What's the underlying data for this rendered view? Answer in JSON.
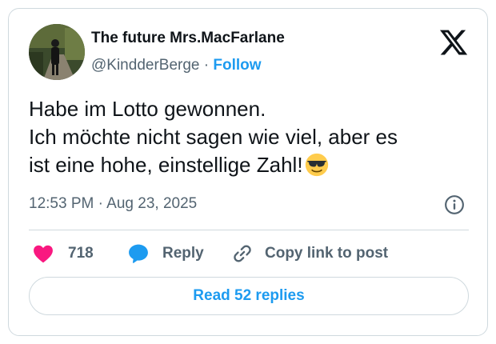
{
  "author": {
    "display_name": "The future Mrs.MacFarlane",
    "handle": "@KindderBerge",
    "separator": "·",
    "follow_label": "Follow"
  },
  "tweet": {
    "lines": [
      "Habe im Lotto gewonnen.",
      "Ich möchte nicht sagen wie viel, aber es",
      "ist eine hohe, einstellige Zahl!"
    ],
    "emoji": "smiling-face-with-sunglasses",
    "timestamp": "12:53 PM · Aug 23, 2025"
  },
  "actions": {
    "like_count": "718",
    "reply_label": "Reply",
    "copy_link_label": "Copy link to post",
    "read_replies_label": "Read 52 replies"
  },
  "colors": {
    "accent": "#1d9bf0",
    "like": "#f91880",
    "muted_text": "#536471",
    "border": "#cfd9de"
  },
  "icons": [
    "x-logo-icon",
    "info-icon",
    "heart-icon",
    "reply-bubble-icon",
    "link-icon",
    "sunglasses-emoji-icon"
  ]
}
